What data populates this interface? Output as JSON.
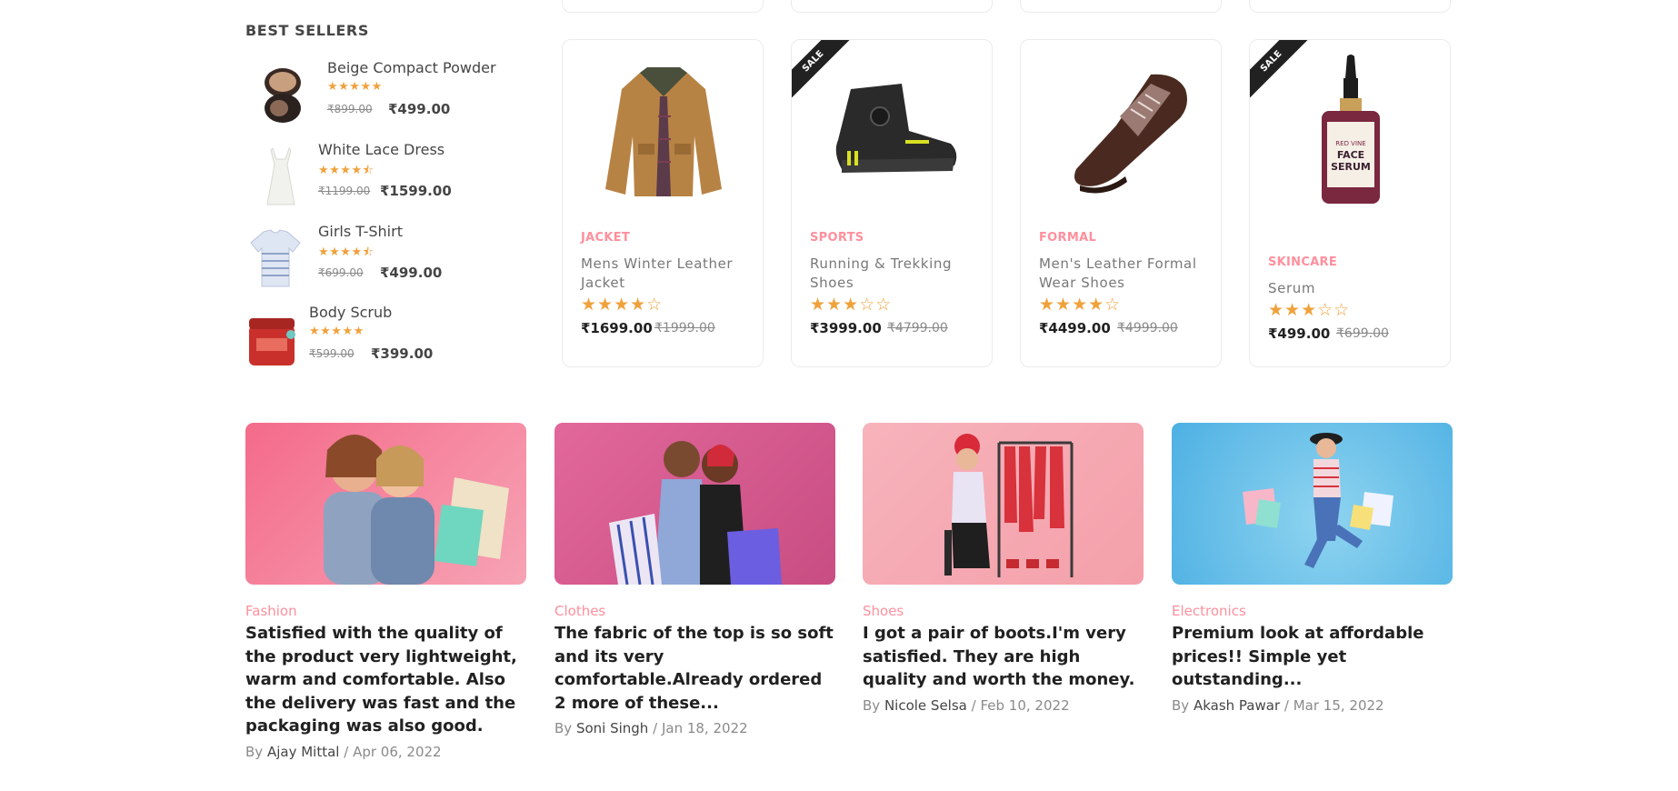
{
  "best_sellers": {
    "title": "BEST SELLERS",
    "items": [
      {
        "name": "Beige Compact Powder",
        "stars": "★★★★★",
        "old_price": "₹899.00",
        "new_price": "₹499.00"
      },
      {
        "name": "White Lace Dress",
        "stars": "★★★★⯪",
        "old_price": "₹1199.00",
        "new_price": "₹1599.00"
      },
      {
        "name": "Girls T-Shirt",
        "stars": "★★★★⯪",
        "old_price": "₹699.00",
        "new_price": "₹499.00"
      },
      {
        "name": "Body Scrub",
        "stars": "★★★★★",
        "old_price": "₹599.00",
        "new_price": "₹399.00"
      }
    ]
  },
  "products": [
    {
      "category": "JACKET",
      "title": "Mens Winter Leather Jacket",
      "stars": "★★★★☆",
      "rating": 4,
      "price": "₹1699.00",
      "old_price": "₹1999.00",
      "sale": ""
    },
    {
      "category": "SPORTS",
      "title": "Running & Trekking Shoes",
      "stars": "★★★☆☆",
      "rating": 3,
      "price": "₹3999.00",
      "old_price": "₹4799.00",
      "sale": "SALE"
    },
    {
      "category": "FORMAL",
      "title": "Men's Leather Formal Wear Shoes",
      "stars": "★★★★☆",
      "rating": 4,
      "price": "₹4499.00",
      "old_price": "₹4999.00",
      "sale": ""
    },
    {
      "category": "SKINCARE",
      "title": "Serum",
      "stars": "★★★☆☆",
      "rating": 3,
      "price": "₹499.00",
      "old_price": "₹699.00",
      "sale": "SALE"
    }
  ],
  "serum_label": {
    "line1": "RED VINE",
    "line2": "FACE",
    "line3": "SERUM"
  },
  "blogs": [
    {
      "category": "Fashion",
      "title": "Satisfied with the quality of the product very lightweight, warm and comfortable. Also the delivery was fast and the packaging was also good.",
      "by": "By",
      "author": "Ajay Mittal",
      "sep": "/",
      "date": "Apr 06, 2022"
    },
    {
      "category": "Clothes",
      "title": "The fabric of the top is so soft and its very comfortable.Already ordered 2 more of these...",
      "by": "By",
      "author": "Soni Singh",
      "sep": "/",
      "date": "Jan 18, 2022"
    },
    {
      "category": "Shoes",
      "title": "I got a pair of boots.I'm very satisfied. They are high quality and worth the money.",
      "by": "By",
      "author": "Nicole Selsa",
      "sep": "/",
      "date": "Feb 10, 2022"
    },
    {
      "category": "Electronics",
      "title": "Premium look at affordable prices!! Simple yet outstanding...",
      "by": "By",
      "author": "Akash Pawar",
      "sep": "/",
      "date": "Mar 15, 2022"
    }
  ],
  "colors": {
    "accent": "#ff8f9c",
    "star": "#f0a13b",
    "text": "#212121",
    "muted": "#8a8a8a"
  }
}
